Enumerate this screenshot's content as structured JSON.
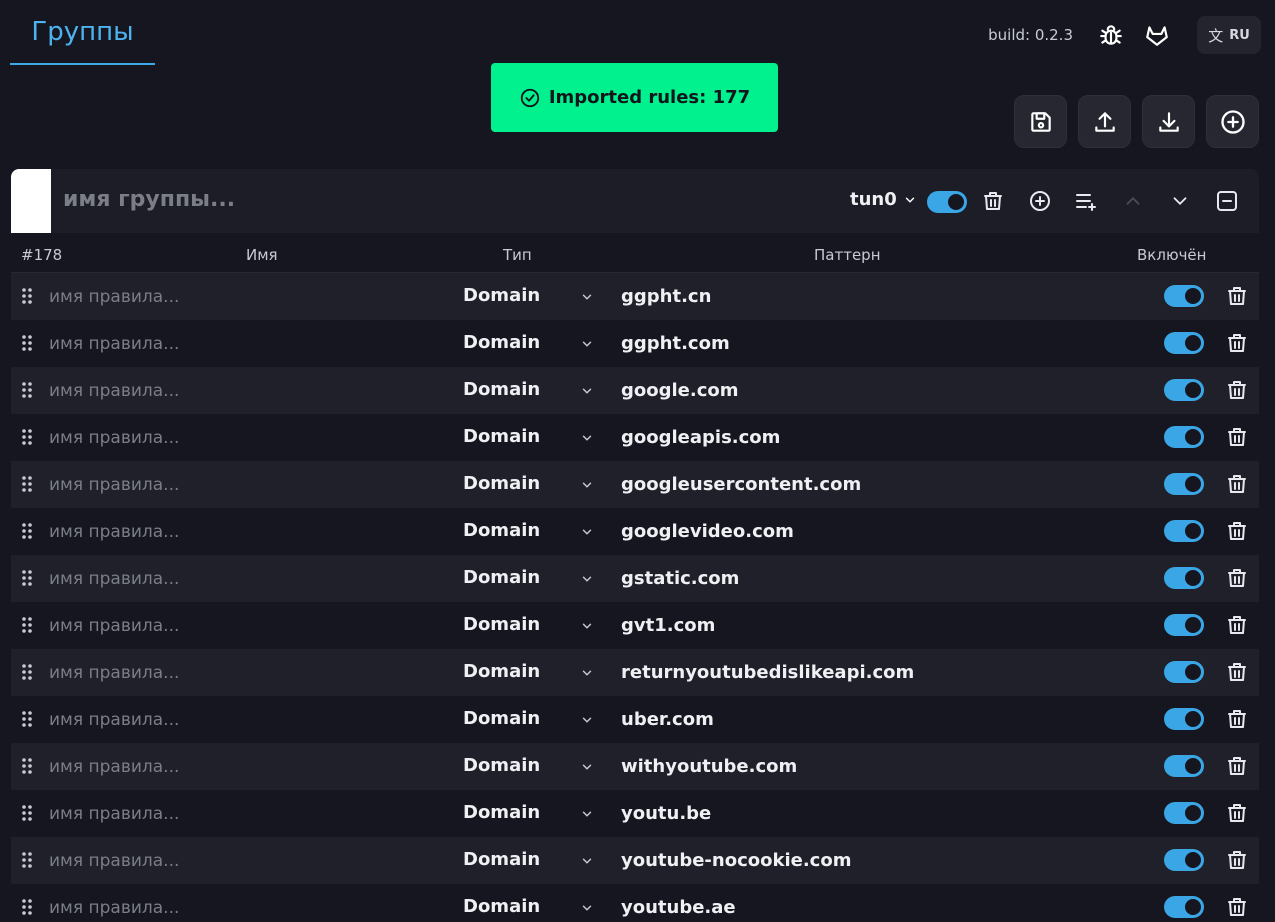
{
  "header": {
    "tab_title": "Группы",
    "build": "build: 0.2.3",
    "lang": "RU",
    "icons": [
      "bug-icon",
      "gitlab-icon",
      "translate-icon"
    ]
  },
  "toast": {
    "text": "Imported rules: 177",
    "color": "#00f18e"
  },
  "toolbar": {
    "buttons": [
      "save-icon",
      "upload-icon",
      "download-icon",
      "add-circle-icon"
    ]
  },
  "group": {
    "name_placeholder": "имя группы...",
    "color": "#ffffff",
    "interface": "tun0",
    "enabled": true
  },
  "table": {
    "headers": {
      "count": "#178",
      "name": "Имя",
      "type": "Тип",
      "pattern": "Паттерн",
      "enabled": "Включён"
    },
    "name_placeholder": "имя правила...",
    "rows": [
      {
        "type": "Domain",
        "pattern": "ggpht.cn",
        "enabled": true
      },
      {
        "type": "Domain",
        "pattern": "ggpht.com",
        "enabled": true
      },
      {
        "type": "Domain",
        "pattern": "google.com",
        "enabled": true
      },
      {
        "type": "Domain",
        "pattern": "googleapis.com",
        "enabled": true
      },
      {
        "type": "Domain",
        "pattern": "googleusercontent.com",
        "enabled": true
      },
      {
        "type": "Domain",
        "pattern": "googlevideo.com",
        "enabled": true
      },
      {
        "type": "Domain",
        "pattern": "gstatic.com",
        "enabled": true
      },
      {
        "type": "Domain",
        "pattern": "gvt1.com",
        "enabled": true
      },
      {
        "type": "Domain",
        "pattern": "returnyoutubedislikeapi.com",
        "enabled": true
      },
      {
        "type": "Domain",
        "pattern": "uber.com",
        "enabled": true
      },
      {
        "type": "Domain",
        "pattern": "withyoutube.com",
        "enabled": true
      },
      {
        "type": "Domain",
        "pattern": "youtu.be",
        "enabled": true
      },
      {
        "type": "Domain",
        "pattern": "youtube-nocookie.com",
        "enabled": true
      },
      {
        "type": "Domain",
        "pattern": "youtube.ae",
        "enabled": true
      }
    ]
  },
  "colors": {
    "accent": "#3aa6e6",
    "background": "#15161f"
  }
}
